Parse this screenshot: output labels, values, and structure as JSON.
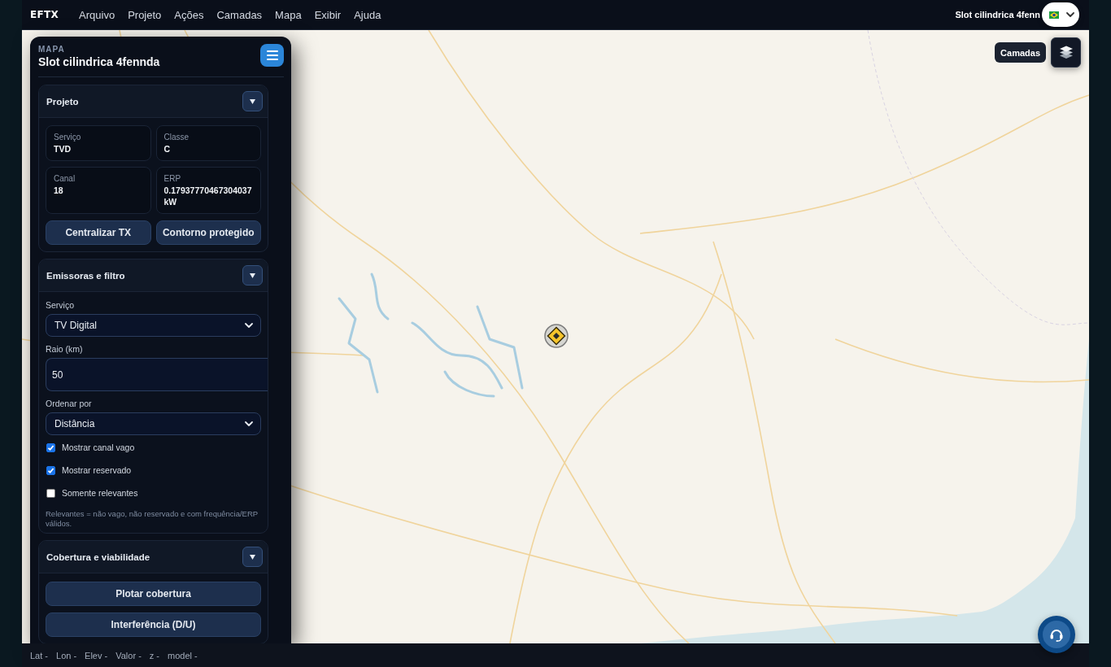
{
  "top_bar": {
    "brand": "EFTX",
    "menu": [
      "Arquivo",
      "Projeto",
      "Ações",
      "Camadas",
      "Mapa",
      "Exibir",
      "Ajuda"
    ],
    "title": "Slot cilindrica 4fenn"
  },
  "map": {
    "layers_label": "Camadas"
  },
  "panel": {
    "eyebrow": "MAPA",
    "title": "Slot cilindrica 4fennda",
    "sections": [
      {
        "kind": "summary",
        "title": "Projeto",
        "expanded": true,
        "fields": [
          {
            "label": "Serviço",
            "value": "TVD"
          },
          {
            "label": "Classe",
            "value": "C"
          },
          {
            "label": "Canal",
            "value": "18"
          },
          {
            "label": "ERP",
            "value": "0.17937770467304037 kW"
          }
        ],
        "buttons": [
          "Centralizar TX",
          "Contorno protegido"
        ]
      },
      {
        "kind": "filter",
        "title": "Emissoras e filtro",
        "expanded": true,
        "controls": [
          {
            "kind": "select",
            "label": "Serviço",
            "value": "TV Digital"
          },
          {
            "kind": "input",
            "label": "Raio (km)",
            "value": "50"
          },
          {
            "kind": "select",
            "label": "Ordenar por",
            "value": "Distância"
          },
          {
            "kind": "checkbox",
            "label": "Mostrar canal vago",
            "checked": true
          },
          {
            "kind": "checkbox",
            "label": "Mostrar reservado",
            "checked": true
          },
          {
            "kind": "checkbox",
            "label": "Somente relevantes",
            "checked": false
          }
        ],
        "hint": "Relevantes = não vago, não reservado e com frequência/ERP válidos."
      },
      {
        "kind": "actions",
        "title": "Cobertura e viabilidade",
        "expanded": true,
        "buttons": [
          "Plotar cobertura",
          "Interferência (D/U)"
        ]
      }
    ]
  },
  "status_bar": [
    "Lat -",
    "Lon -",
    "Elev -",
    "Valor -",
    "z -",
    "model -"
  ]
}
